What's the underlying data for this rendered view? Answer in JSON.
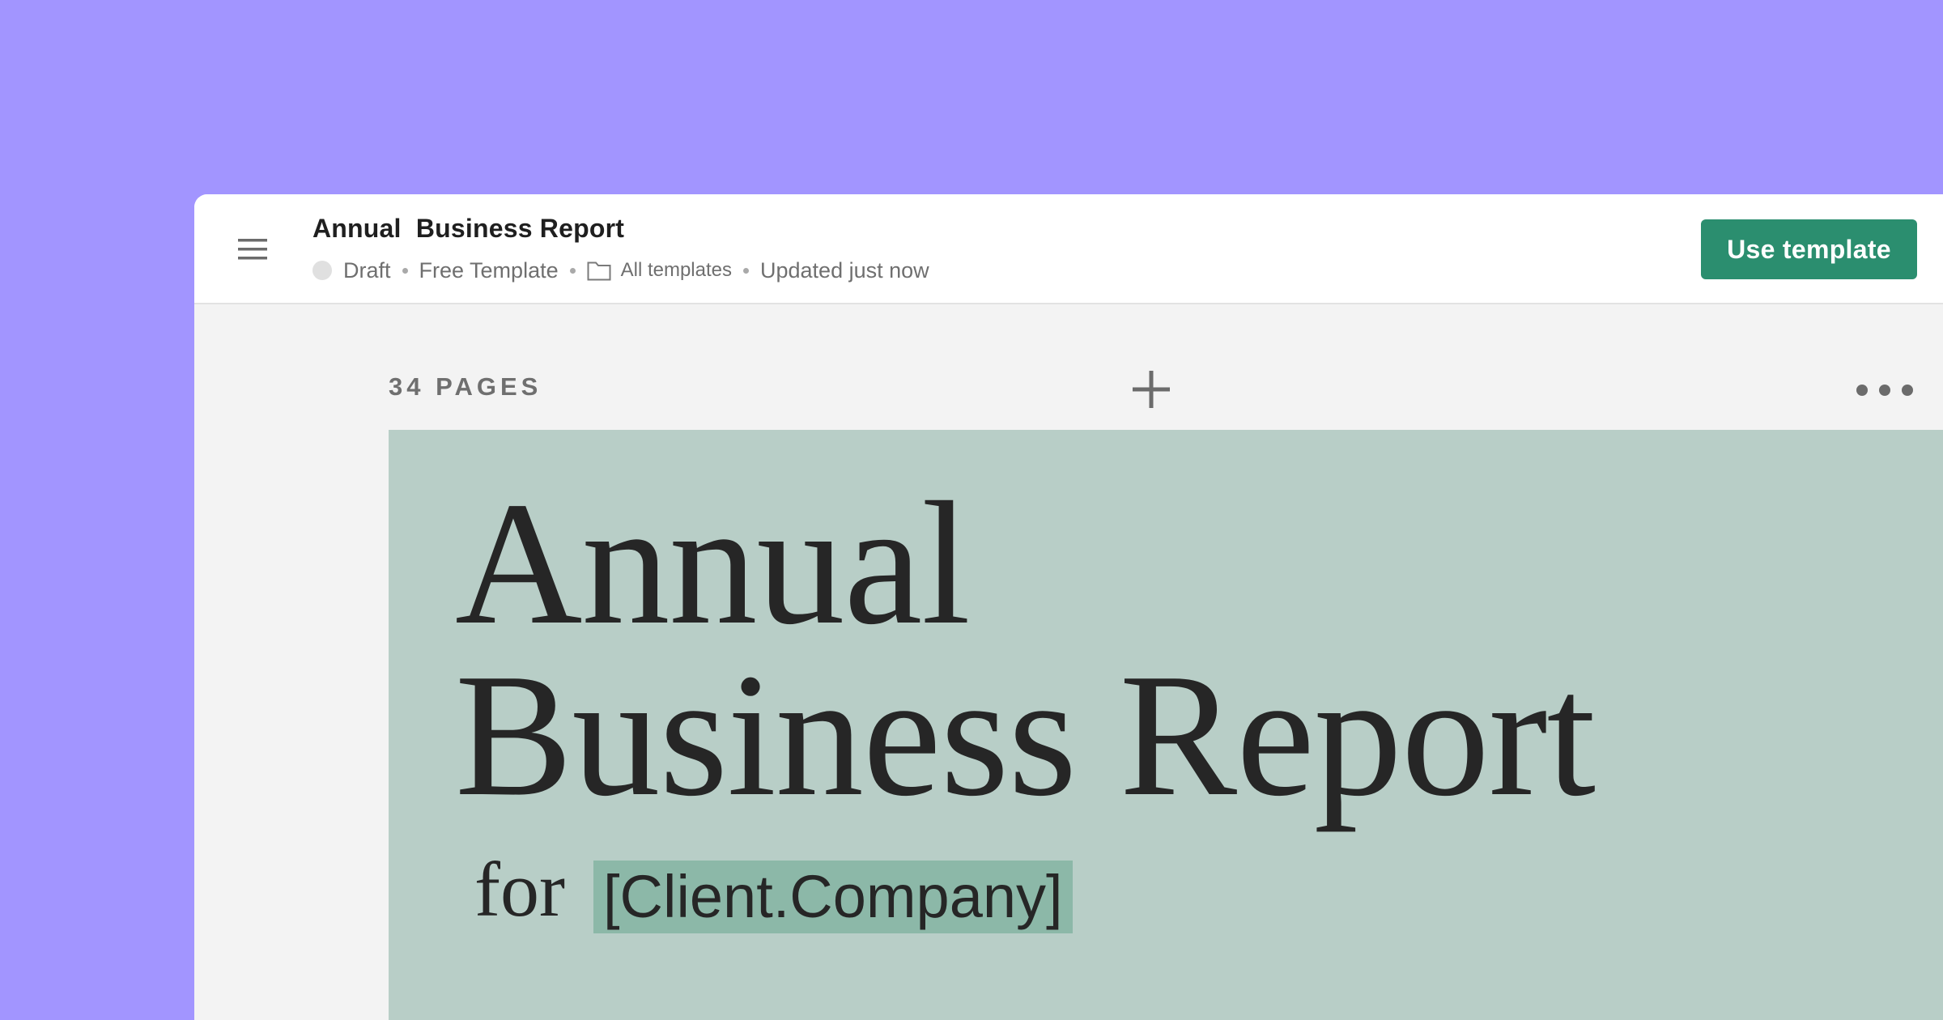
{
  "header": {
    "title": "Annual  Business Report",
    "status": "Draft",
    "template_type": "Free Template",
    "folder": "All templates",
    "updated": "Updated just now",
    "cta_label": "Use template"
  },
  "editor": {
    "pages_count": "34 PAGES"
  },
  "cover": {
    "title_line1": "Annual",
    "title_line2": "Business Report",
    "for_label": "for",
    "client_placeholder": "[Client.Company]"
  },
  "colors": {
    "background": "#a295ff",
    "accent": "#2b8e6f",
    "page_background": "#b8cec7",
    "placeholder_highlight": "#8cb8a8"
  },
  "icons": {
    "menu": "hamburger-menu-icon",
    "folder": "folder-icon",
    "add_page": "plus-icon",
    "more": "more-horizontal-icon"
  }
}
